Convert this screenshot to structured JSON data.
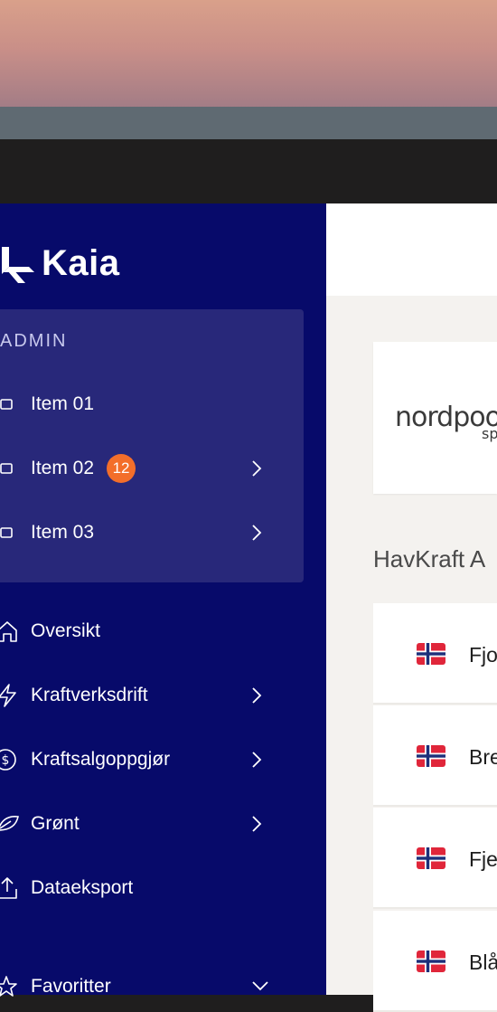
{
  "brand": {
    "name": "Kaia"
  },
  "admin": {
    "title": "ADMIN",
    "items": [
      {
        "label": "Item 01",
        "badge": null,
        "has_chevron": false
      },
      {
        "label": "Item 02",
        "badge": "12",
        "has_chevron": true
      },
      {
        "label": "Item 03",
        "badge": null,
        "has_chevron": true
      }
    ]
  },
  "nav": {
    "items": [
      {
        "label": "Oversikt",
        "icon": "home-icon",
        "has_chevron": false
      },
      {
        "label": "Kraftverksdrift",
        "icon": "lightning-icon",
        "has_chevron": true
      },
      {
        "label": "Kraftsalgoppgjør",
        "icon": "dollar-icon",
        "has_chevron": true
      },
      {
        "label": "Grønt",
        "icon": "leaf-icon",
        "has_chevron": true
      },
      {
        "label": "Dataeksport",
        "icon": "upload-icon",
        "has_chevron": false
      },
      {
        "label": "Favoritter",
        "icon": "star-icon",
        "has_chevron": true
      }
    ]
  },
  "main": {
    "sponsor": {
      "logo_text": "nordpoo",
      "logo_sub": "sp"
    },
    "section_title": "HavKraft A",
    "plants": [
      {
        "name": "Fjo",
        "flag": "norway-flag-icon"
      },
      {
        "name": "Bre",
        "flag": "norway-flag-icon"
      },
      {
        "name": "Fje",
        "flag": "norway-flag-icon"
      },
      {
        "name": "Blå",
        "flag": "norway-flag-icon"
      }
    ]
  },
  "colors": {
    "sidebar_bg": "#070a6a",
    "admin_bg": "#28287a",
    "badge": "#f36e2a",
    "main_bg": "#f4f2ef"
  }
}
